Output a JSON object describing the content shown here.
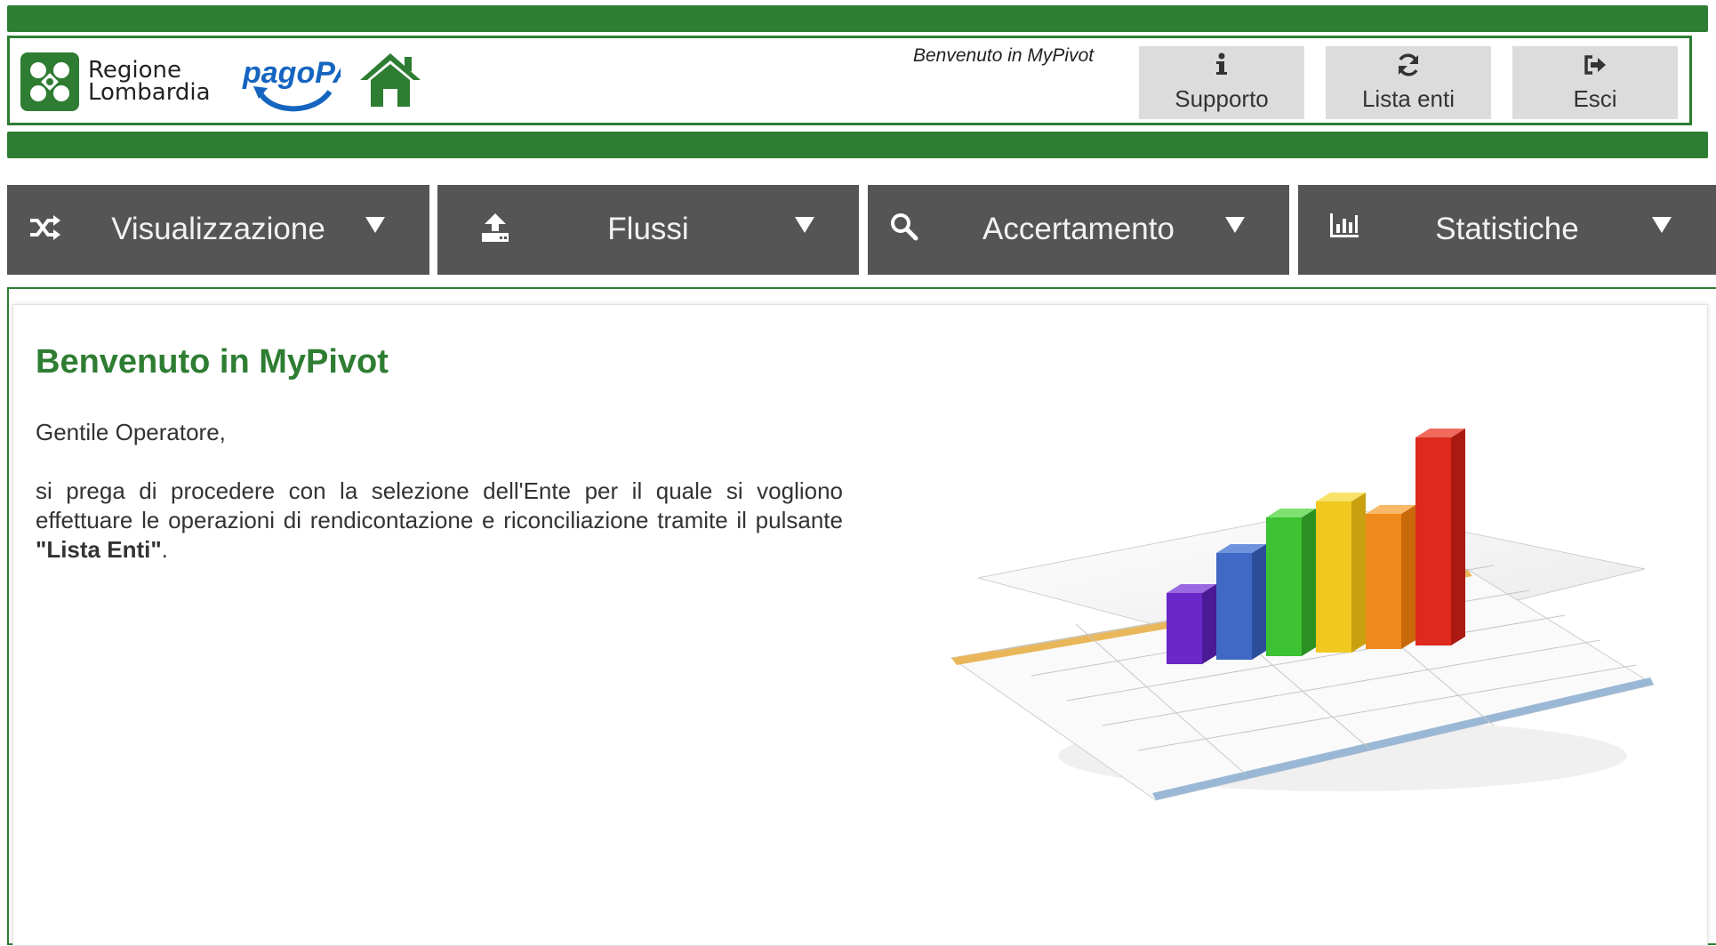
{
  "header": {
    "logo_text_line1": "Regione",
    "logo_text_line2": "Lombardia",
    "pagopa_logo_text": "pagoPA",
    "welcome_text": "Benvenuto in MyPivot",
    "buttons": [
      {
        "label": "Supporto",
        "icon": "info-icon"
      },
      {
        "label": "Lista enti",
        "icon": "refresh-icon"
      },
      {
        "label": "Esci",
        "icon": "sign-out-icon"
      }
    ]
  },
  "menu": [
    {
      "label": "Visualizzazione",
      "icon": "shuffle-icon"
    },
    {
      "label": "Flussi",
      "icon": "upload-icon"
    },
    {
      "label": "Accertamento",
      "icon": "search-icon"
    },
    {
      "label": "Statistiche",
      "icon": "bar-chart-icon"
    }
  ],
  "main": {
    "title": "Benvenuto in MyPivot",
    "greeting": "Gentile Operatore,",
    "paragraph_prefix": "si prega di procedere con la selezione dell'Ente per il quale si vogliono effettuare le operazioni di rendicontazione e riconciliazione tramite il pulsante ",
    "paragraph_bold": "\"Lista Enti\"",
    "paragraph_suffix": "."
  },
  "colors": {
    "brand_green": "#2e7d32",
    "menu_bg": "#555555",
    "header_button_bg": "#dcdcdc"
  }
}
